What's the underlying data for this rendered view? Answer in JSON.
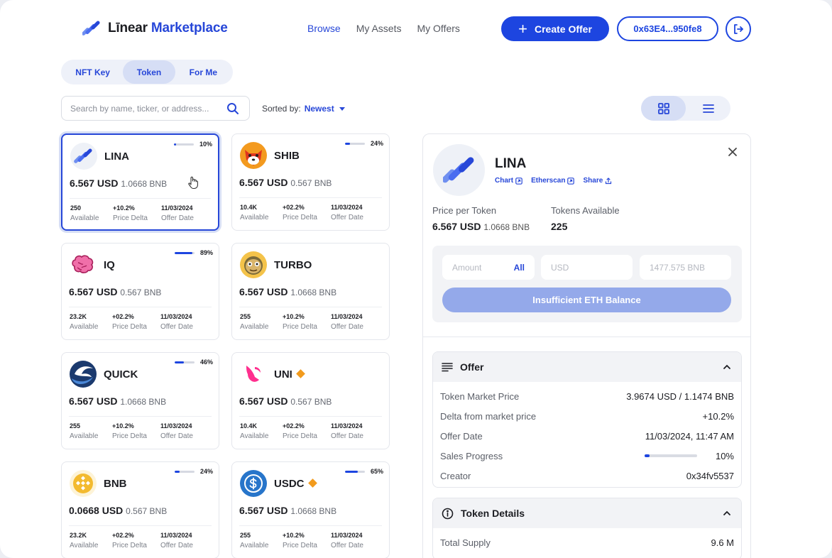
{
  "header": {
    "logo_prefix": "Līnear",
    "logo_suffix": "Marketplace",
    "nav": [
      "Browse",
      "My Assets",
      "My Offers"
    ],
    "create_label": "Create Offer",
    "wallet_label": "0x63E4...950fe8"
  },
  "tabs": [
    "NFT Key",
    "Token",
    "For Me"
  ],
  "active_tab": "Token",
  "search": {
    "placeholder": "Search by name, ticker, or address..."
  },
  "sort": {
    "label": "Sorted by:",
    "value": "Newest"
  },
  "stat_labels": {
    "available": "Available",
    "delta": "Price Delta",
    "date": "Offer Date"
  },
  "cards": [
    {
      "name": "LINA",
      "progress": "10%",
      "progress_value": 0.1,
      "usd": "6.567 USD",
      "bnb": "1.0668 BNB",
      "available": "250",
      "delta": "+10.2%",
      "date": "11/03/2024",
      "icon": "lina-icon"
    },
    {
      "name": "SHIB",
      "progress": "24%",
      "progress_value": 0.24,
      "usd": "6.567 USD",
      "bnb": "0.567 BNB",
      "available": "10.4K",
      "delta": "+02.2%",
      "date": "11/03/2024",
      "icon": "shib-icon"
    },
    {
      "name": "IQ",
      "progress": "89%",
      "progress_value": 0.89,
      "usd": "6.567 USD",
      "bnb": "0.567 BNB",
      "available": "23.2K",
      "delta": "+02.2%",
      "date": "11/03/2024",
      "icon": "iq-brain-icon"
    },
    {
      "name": "TURBO",
      "progress": "",
      "progress_value": 0,
      "usd": "6.567 USD",
      "bnb": "1.0668 BNB",
      "available": "255",
      "delta": "+10.2%",
      "date": "11/03/2024",
      "icon": "turbo-icon"
    },
    {
      "name": "QUICK",
      "progress": "46%",
      "progress_value": 0.46,
      "usd": "6.567 USD",
      "bnb": "1.0668 BNB",
      "available": "255",
      "delta": "+10.2%",
      "date": "11/03/2024",
      "icon": "quick-icon"
    },
    {
      "name": "UNI",
      "progress": "",
      "progress_value": 0,
      "usd": "6.567 USD",
      "bnb": "0.567 BNB",
      "available": "10.4K",
      "delta": "+02.2%",
      "date": "11/03/2024",
      "icon": "uni-icon"
    },
    {
      "name": "BNB",
      "progress": "24%",
      "progress_value": 0.24,
      "usd": "0.0668 USD",
      "bnb": "0.567 BNB",
      "available": "23.2K",
      "delta": "+02.2%",
      "date": "11/03/2024",
      "icon": "bnb-icon"
    },
    {
      "name": "USDC",
      "progress": "65%",
      "progress_value": 0.65,
      "usd": "6.567 USD",
      "bnb": "1.0668 BNB",
      "available": "255",
      "delta": "+10.2%",
      "date": "11/03/2024",
      "icon": "usdc-icon"
    }
  ],
  "detail": {
    "name": "LINA",
    "links": [
      "Chart",
      "Etherscan",
      "Share"
    ],
    "price_label": "Price per Token",
    "price_usd": "6.567 USD",
    "price_bnb": "1.0668 BNB",
    "tokens_label": "Tokens Available",
    "tokens_value": "225",
    "amount_placeholder": "Amount",
    "all_label": "All",
    "usd_placeholder": "USD",
    "bnb_placeholder": "1477.575 BNB",
    "button_label": "Insufficient ETH Balance",
    "offer_title": "Offer",
    "offer_rows": [
      {
        "k": "Token Market Price",
        "v": "3.9674 USD / 1.1474 BNB"
      },
      {
        "k": "Delta from market price",
        "v": "+10.2%"
      },
      {
        "k": "Offer Date",
        "v": "11/03/2024, 11:47 AM"
      },
      {
        "k": "Sales Progress",
        "v": "10%",
        "progress_value": 0.1
      },
      {
        "k": "Creator",
        "v": "0x34fv5537"
      }
    ],
    "token_title": "Token Details",
    "token_rows": [
      {
        "k": "Total Supply",
        "v": "9.6 M"
      }
    ]
  },
  "colors": {
    "accent": "#1d45e0",
    "tab_bg": "#eef1f9",
    "tab_active": "#d6def5",
    "warning": "#f29b1d"
  }
}
